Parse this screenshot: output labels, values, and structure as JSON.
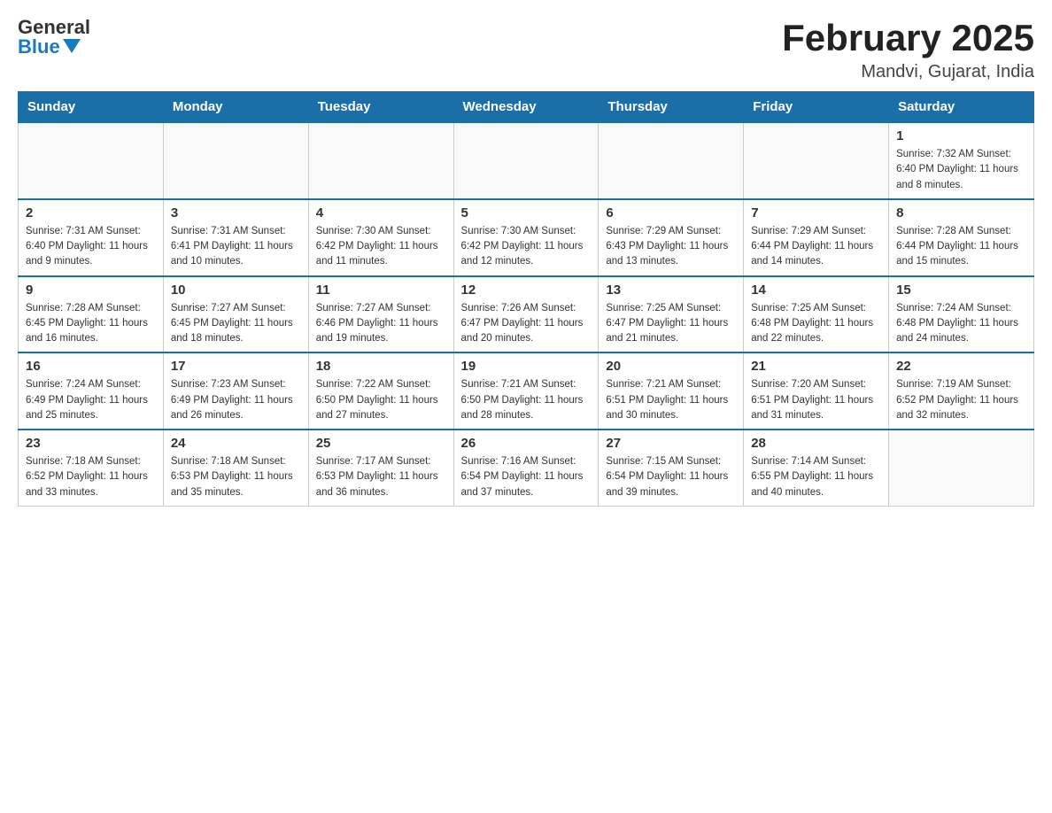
{
  "logo": {
    "general": "General",
    "blue": "Blue"
  },
  "title": "February 2025",
  "location": "Mandvi, Gujarat, India",
  "weekdays": [
    "Sunday",
    "Monday",
    "Tuesday",
    "Wednesday",
    "Thursday",
    "Friday",
    "Saturday"
  ],
  "weeks": [
    [
      {
        "day": "",
        "info": ""
      },
      {
        "day": "",
        "info": ""
      },
      {
        "day": "",
        "info": ""
      },
      {
        "day": "",
        "info": ""
      },
      {
        "day": "",
        "info": ""
      },
      {
        "day": "",
        "info": ""
      },
      {
        "day": "1",
        "info": "Sunrise: 7:32 AM\nSunset: 6:40 PM\nDaylight: 11 hours and 8 minutes."
      }
    ],
    [
      {
        "day": "2",
        "info": "Sunrise: 7:31 AM\nSunset: 6:40 PM\nDaylight: 11 hours and 9 minutes."
      },
      {
        "day": "3",
        "info": "Sunrise: 7:31 AM\nSunset: 6:41 PM\nDaylight: 11 hours and 10 minutes."
      },
      {
        "day": "4",
        "info": "Sunrise: 7:30 AM\nSunset: 6:42 PM\nDaylight: 11 hours and 11 minutes."
      },
      {
        "day": "5",
        "info": "Sunrise: 7:30 AM\nSunset: 6:42 PM\nDaylight: 11 hours and 12 minutes."
      },
      {
        "day": "6",
        "info": "Sunrise: 7:29 AM\nSunset: 6:43 PM\nDaylight: 11 hours and 13 minutes."
      },
      {
        "day": "7",
        "info": "Sunrise: 7:29 AM\nSunset: 6:44 PM\nDaylight: 11 hours and 14 minutes."
      },
      {
        "day": "8",
        "info": "Sunrise: 7:28 AM\nSunset: 6:44 PM\nDaylight: 11 hours and 15 minutes."
      }
    ],
    [
      {
        "day": "9",
        "info": "Sunrise: 7:28 AM\nSunset: 6:45 PM\nDaylight: 11 hours and 16 minutes."
      },
      {
        "day": "10",
        "info": "Sunrise: 7:27 AM\nSunset: 6:45 PM\nDaylight: 11 hours and 18 minutes."
      },
      {
        "day": "11",
        "info": "Sunrise: 7:27 AM\nSunset: 6:46 PM\nDaylight: 11 hours and 19 minutes."
      },
      {
        "day": "12",
        "info": "Sunrise: 7:26 AM\nSunset: 6:47 PM\nDaylight: 11 hours and 20 minutes."
      },
      {
        "day": "13",
        "info": "Sunrise: 7:25 AM\nSunset: 6:47 PM\nDaylight: 11 hours and 21 minutes."
      },
      {
        "day": "14",
        "info": "Sunrise: 7:25 AM\nSunset: 6:48 PM\nDaylight: 11 hours and 22 minutes."
      },
      {
        "day": "15",
        "info": "Sunrise: 7:24 AM\nSunset: 6:48 PM\nDaylight: 11 hours and 24 minutes."
      }
    ],
    [
      {
        "day": "16",
        "info": "Sunrise: 7:24 AM\nSunset: 6:49 PM\nDaylight: 11 hours and 25 minutes."
      },
      {
        "day": "17",
        "info": "Sunrise: 7:23 AM\nSunset: 6:49 PM\nDaylight: 11 hours and 26 minutes."
      },
      {
        "day": "18",
        "info": "Sunrise: 7:22 AM\nSunset: 6:50 PM\nDaylight: 11 hours and 27 minutes."
      },
      {
        "day": "19",
        "info": "Sunrise: 7:21 AM\nSunset: 6:50 PM\nDaylight: 11 hours and 28 minutes."
      },
      {
        "day": "20",
        "info": "Sunrise: 7:21 AM\nSunset: 6:51 PM\nDaylight: 11 hours and 30 minutes."
      },
      {
        "day": "21",
        "info": "Sunrise: 7:20 AM\nSunset: 6:51 PM\nDaylight: 11 hours and 31 minutes."
      },
      {
        "day": "22",
        "info": "Sunrise: 7:19 AM\nSunset: 6:52 PM\nDaylight: 11 hours and 32 minutes."
      }
    ],
    [
      {
        "day": "23",
        "info": "Sunrise: 7:18 AM\nSunset: 6:52 PM\nDaylight: 11 hours and 33 minutes."
      },
      {
        "day": "24",
        "info": "Sunrise: 7:18 AM\nSunset: 6:53 PM\nDaylight: 11 hours and 35 minutes."
      },
      {
        "day": "25",
        "info": "Sunrise: 7:17 AM\nSunset: 6:53 PM\nDaylight: 11 hours and 36 minutes."
      },
      {
        "day": "26",
        "info": "Sunrise: 7:16 AM\nSunset: 6:54 PM\nDaylight: 11 hours and 37 minutes."
      },
      {
        "day": "27",
        "info": "Sunrise: 7:15 AM\nSunset: 6:54 PM\nDaylight: 11 hours and 39 minutes."
      },
      {
        "day": "28",
        "info": "Sunrise: 7:14 AM\nSunset: 6:55 PM\nDaylight: 11 hours and 40 minutes."
      },
      {
        "day": "",
        "info": ""
      }
    ]
  ]
}
